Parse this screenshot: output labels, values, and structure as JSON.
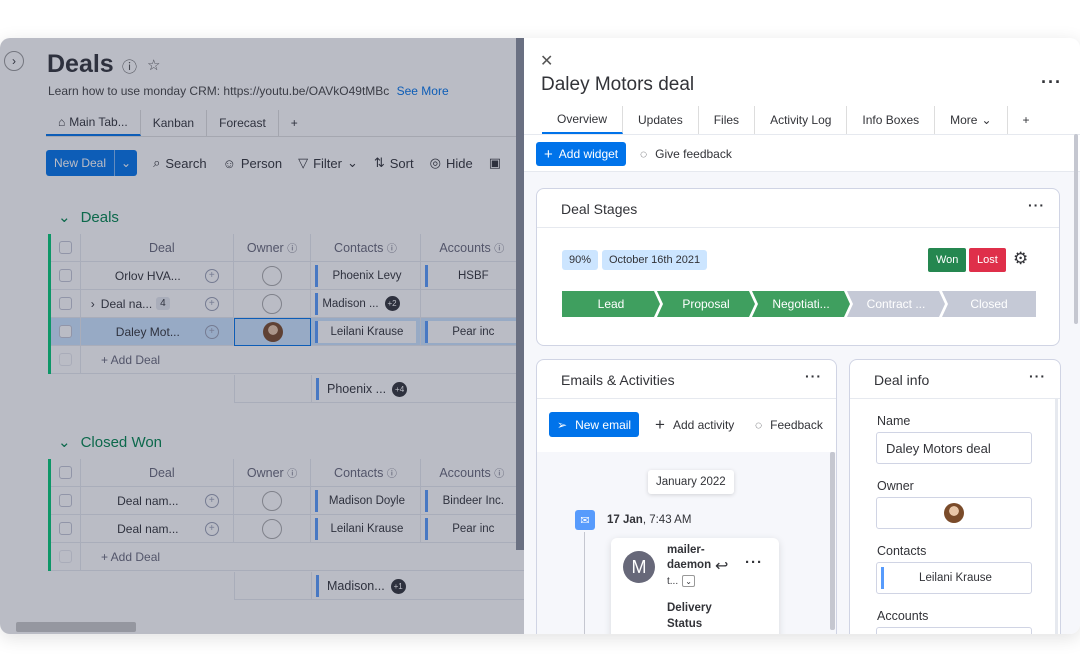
{
  "board": {
    "title": "Deals",
    "description": "Learn how to use monday CRM: https://youtu.be/OAVkO49tMBc",
    "see_more": "See More",
    "views": [
      {
        "label": "Main Tab...",
        "icon": "home-icon"
      },
      {
        "label": "Kanban"
      },
      {
        "label": "Forecast"
      },
      {
        "label": "+"
      }
    ],
    "toolbar": {
      "new_deal": "New Deal",
      "search": "Search",
      "person": "Person",
      "filter": "Filter",
      "sort": "Sort",
      "hide": "Hide"
    },
    "columns": {
      "deal": "Deal",
      "owner": "Owner",
      "contacts": "Contacts",
      "accounts": "Accounts"
    },
    "groups": [
      {
        "name": "Deals",
        "color": "#00c875",
        "rows": [
          {
            "deal": "Orlov HVA...",
            "contact": "Phoenix Levy",
            "account": "HSBF"
          },
          {
            "deal": "Deal na...",
            "subitems": "4",
            "contact": "Madison ...",
            "contact_extra": "+2",
            "account": ""
          },
          {
            "deal": "Daley Mot...",
            "contact": "Leilani Krause",
            "account": "Pear inc"
          }
        ],
        "add_label": "+ Add Deal",
        "summary_contact": "Phoenix ...",
        "summary_extra": "+4"
      },
      {
        "name": "Closed Won",
        "color": "#00c875",
        "rows": [
          {
            "deal": "Deal nam...",
            "contact": "Madison Doyle",
            "account": "Bindeer Inc."
          },
          {
            "deal": "Deal nam...",
            "contact": "Leilani Krause",
            "account": "Pear inc"
          }
        ],
        "add_label": "+ Add Deal",
        "summary_contact": "Madison...",
        "summary_extra": "+1"
      }
    ]
  },
  "panel": {
    "title": "Daley Motors deal",
    "tabs": [
      "Overview",
      "Updates",
      "Files",
      "Activity Log",
      "Info Boxes",
      "More",
      "+"
    ],
    "add_widget": "Add widget",
    "give_feedback": "Give feedback",
    "deal_stages": {
      "title": "Deal Stages",
      "probability": "90%",
      "close_date": "October 16th 2021",
      "won": "Won",
      "lost": "Lost",
      "stages": [
        {
          "label": "Lead",
          "color": "#3f9f5f"
        },
        {
          "label": "Proposal",
          "color": "#3f9f5f"
        },
        {
          "label": "Negotiati...",
          "color": "#3f9f5f"
        },
        {
          "label": "Contract ...",
          "color": "#c5c9d6"
        },
        {
          "label": "Closed",
          "color": "#c5c9d6"
        }
      ]
    },
    "emails": {
      "title": "Emails & Activities",
      "new_email": "New email",
      "add_activity": "Add activity",
      "feedback": "Feedback",
      "date_group": "January 2022",
      "item_date": "17 Jan",
      "item_time": ", 7:43 AM",
      "avatar_letter": "M",
      "sender": "mailer-daemon",
      "sender_sub": "t...",
      "subject": "Delivery Status"
    },
    "deal_info": {
      "title": "Deal info",
      "name_label": "Name",
      "name_value": "Daley Motors deal",
      "owner_label": "Owner",
      "contacts_label": "Contacts",
      "contacts_value": "Leilani Krause",
      "accounts_label": "Accounts"
    }
  }
}
